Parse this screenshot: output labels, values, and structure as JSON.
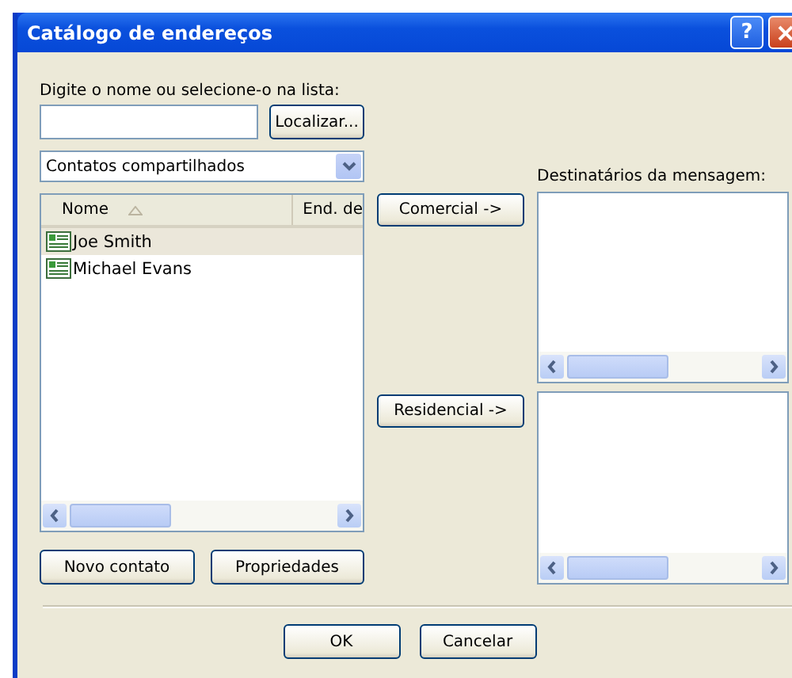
{
  "window": {
    "title": "Catálogo de endereços",
    "help_button": "?"
  },
  "search": {
    "label": "Digite o nome ou selecione-o na lista:",
    "find_button": "Localizar..."
  },
  "folder_dropdown": {
    "value": "Contatos compartilhados"
  },
  "contacts": {
    "columns": [
      {
        "label": "Nome",
        "sorted": true
      },
      {
        "label": "End. de",
        "sorted": false
      }
    ],
    "rows": [
      {
        "name": "Joe Smith",
        "selected": true
      },
      {
        "name": "Michael Evans",
        "selected": false
      }
    ]
  },
  "contact_buttons": [
    "Novo contato",
    "Propriedades"
  ],
  "recipients": {
    "label": "Destinatários da mensagem:",
    "groups": [
      {
        "button": "Comercial ->"
      },
      {
        "button": "Residencial ->"
      }
    ]
  },
  "footer_buttons": [
    "OK",
    "Cancelar"
  ]
}
